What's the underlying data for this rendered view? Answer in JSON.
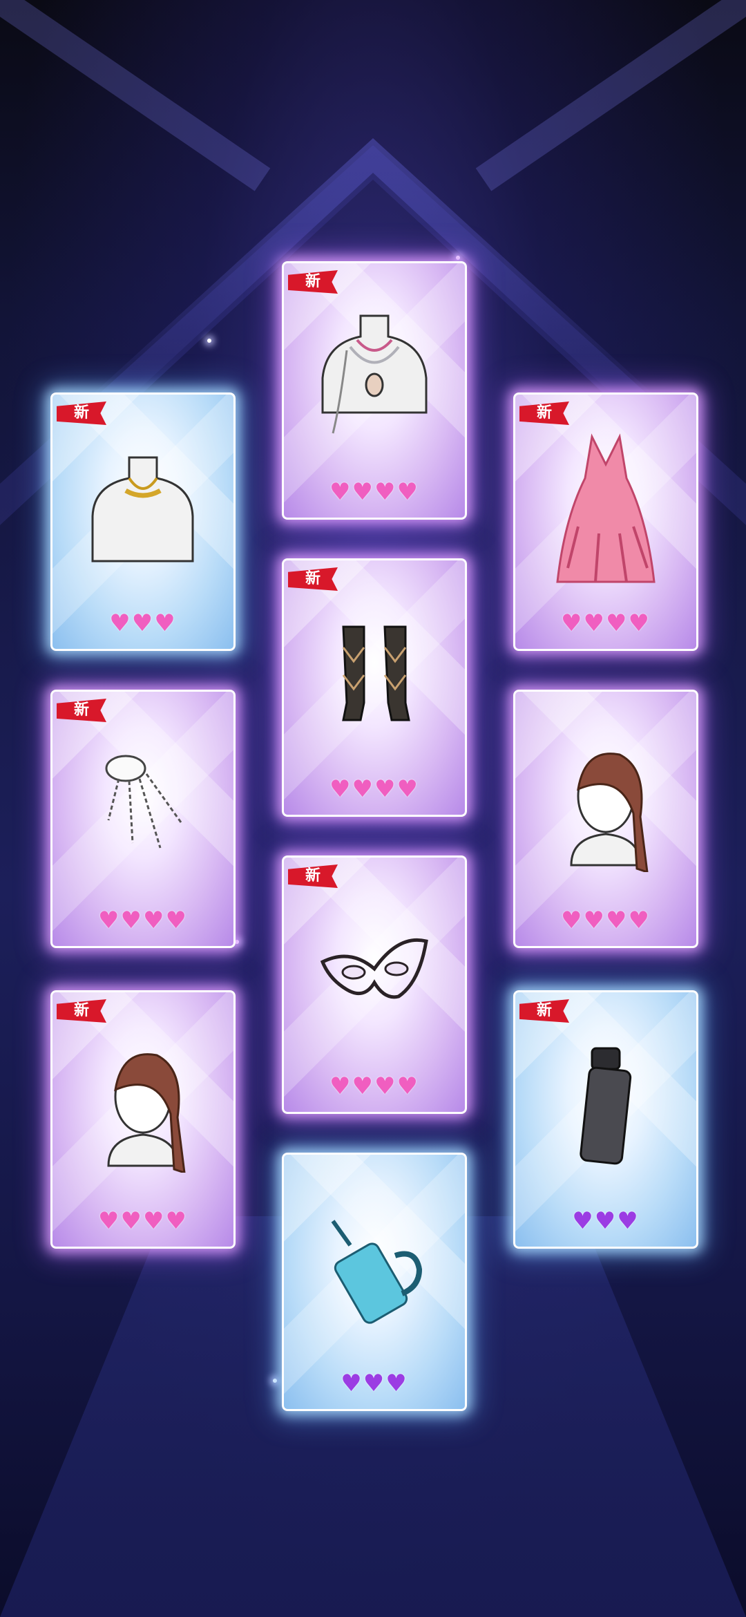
{
  "screen": {
    "badge_label": "新",
    "accent_pink": "#f05ec0",
    "accent_violet": "#9b3ce3"
  },
  "cards": [
    {
      "name": "card-necklace-gold",
      "item": "gold-necklace-icon",
      "rarity": "blue",
      "new": true,
      "hearts": 3,
      "heart_color": "pink"
    },
    {
      "name": "card-necklace-layered",
      "item": "layered-necklace-icon",
      "rarity": "purple",
      "new": true,
      "hearts": 4,
      "heart_color": "pink"
    },
    {
      "name": "card-dress-pink",
      "item": "pink-gown-icon",
      "rarity": "purple",
      "new": true,
      "hearts": 4,
      "heart_color": "pink"
    },
    {
      "name": "card-hair-clip",
      "item": "crystal-hairpin-icon",
      "rarity": "purple",
      "new": true,
      "hearts": 4,
      "heart_color": "pink"
    },
    {
      "name": "card-argyle-socks",
      "item": "argyle-socks-icon",
      "rarity": "purple",
      "new": true,
      "hearts": 4,
      "heart_color": "pink"
    },
    {
      "name": "card-hair-ponytail-right",
      "item": "hairstyle-icon",
      "rarity": "purple",
      "new": false,
      "hearts": 4,
      "heart_color": "pink"
    },
    {
      "name": "card-hair-ponytail-left",
      "item": "hairstyle-icon",
      "rarity": "purple",
      "new": true,
      "hearts": 4,
      "heart_color": "pink"
    },
    {
      "name": "card-lace-mask",
      "item": "lace-mask-icon",
      "rarity": "purple",
      "new": true,
      "hearts": 4,
      "heart_color": "pink"
    },
    {
      "name": "card-water-bottle",
      "item": "water-bottle-icon",
      "rarity": "blue",
      "new": true,
      "hearts": 3,
      "heart_color": "violet"
    },
    {
      "name": "card-tumbler",
      "item": "tumbler-cup-icon",
      "rarity": "blue",
      "new": false,
      "hearts": 3,
      "heart_color": "violet"
    }
  ]
}
